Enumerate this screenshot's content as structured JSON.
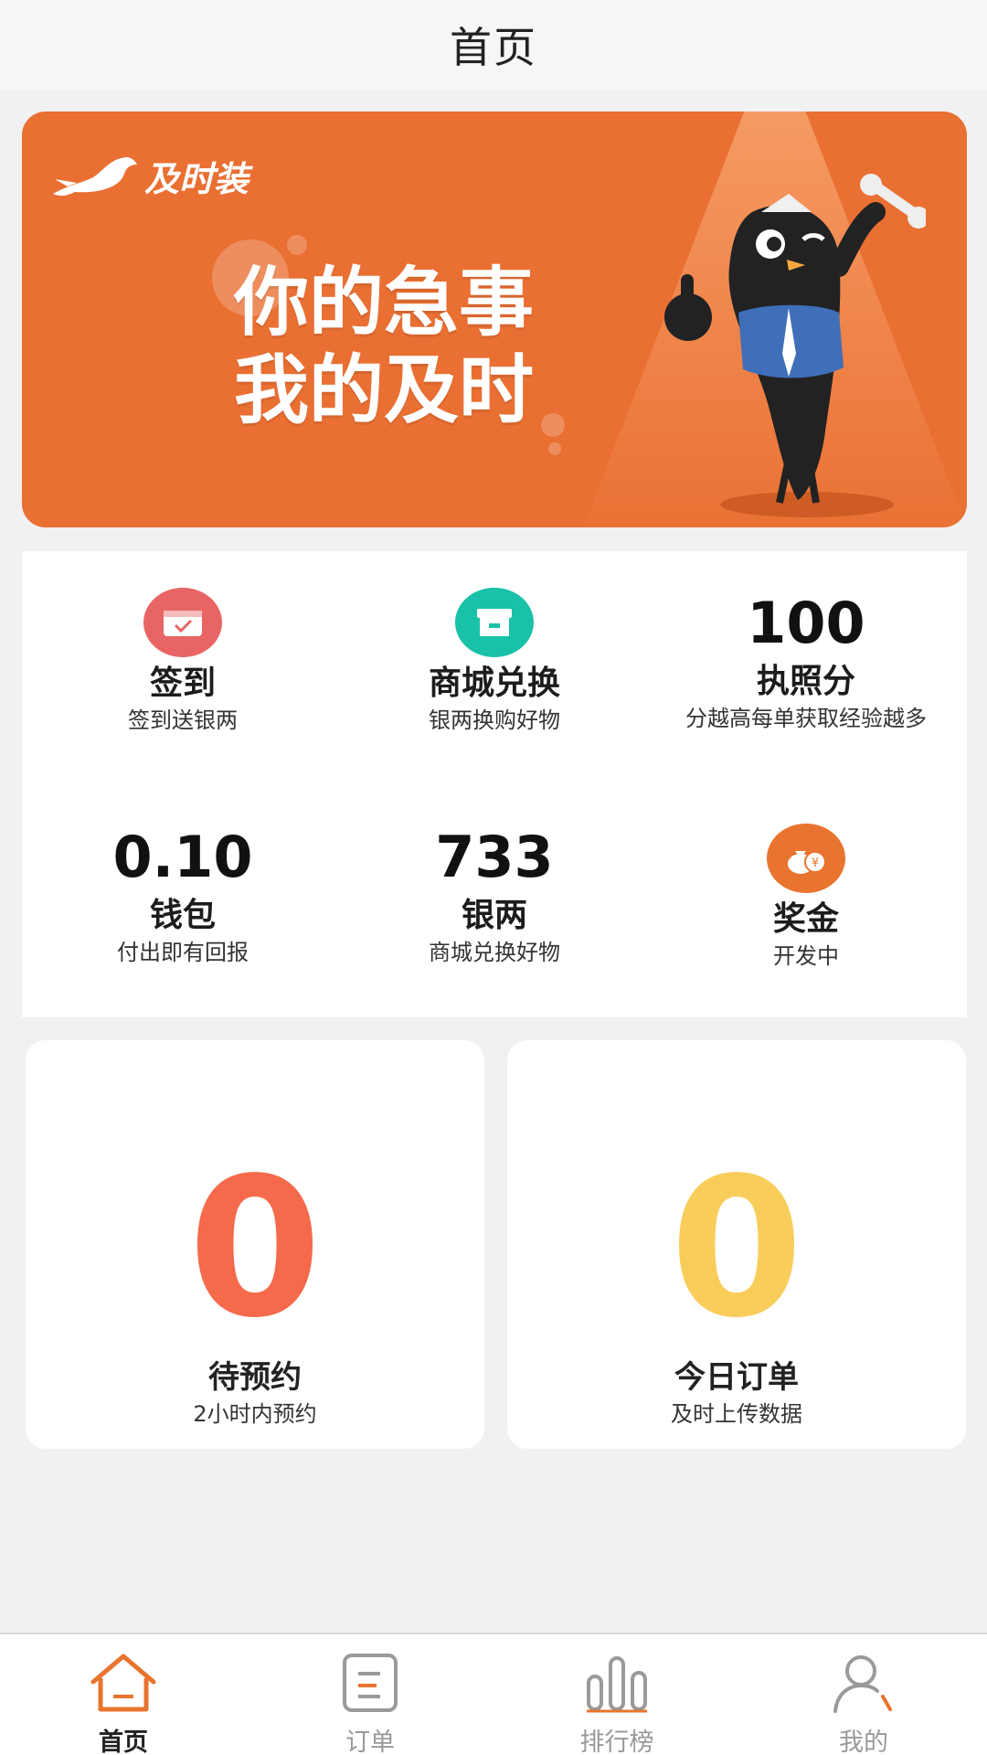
{
  "header": {
    "title": "首页"
  },
  "banner": {
    "logo_text": "及时装",
    "slogan_line1": "你的急事",
    "slogan_line2": "我的及时",
    "accent": "#e96f32"
  },
  "stats": {
    "checkin": {
      "label": "签到",
      "sub": "签到送银两",
      "icon": "calendar-check-icon",
      "icon_color": "#e96565"
    },
    "mall": {
      "label": "商城兑换",
      "sub": "银两换购好物",
      "icon": "shop-icon",
      "icon_color": "#18c1a7"
    },
    "license": {
      "value": "100",
      "label": "执照分",
      "sub": "分越高每单获取经验越多"
    },
    "wallet": {
      "value": "0.10",
      "label": "钱包",
      "sub": "付出即有回报"
    },
    "silver": {
      "value": "733",
      "label": "银两",
      "sub": "商城兑换好物"
    },
    "bonus": {
      "label": "奖金",
      "sub": "开发中",
      "icon": "money-bag-icon",
      "icon_color": "#e8742f"
    }
  },
  "counters": {
    "pending": {
      "value": "0",
      "label": "待预约",
      "sub": "2小时内预约",
      "color": "#f46a4a"
    },
    "today": {
      "value": "0",
      "label": "今日订单",
      "sub": "及时上传数据",
      "color": "#f8cd5a"
    }
  },
  "tabbar": {
    "tabs": [
      {
        "label": "首页",
        "icon": "home-icon",
        "active": true
      },
      {
        "label": "订单",
        "icon": "order-icon",
        "active": false
      },
      {
        "label": "排行榜",
        "icon": "ranking-icon",
        "active": false
      },
      {
        "label": "我的",
        "icon": "profile-icon",
        "active": false
      }
    ],
    "accent": "#e8742f"
  }
}
